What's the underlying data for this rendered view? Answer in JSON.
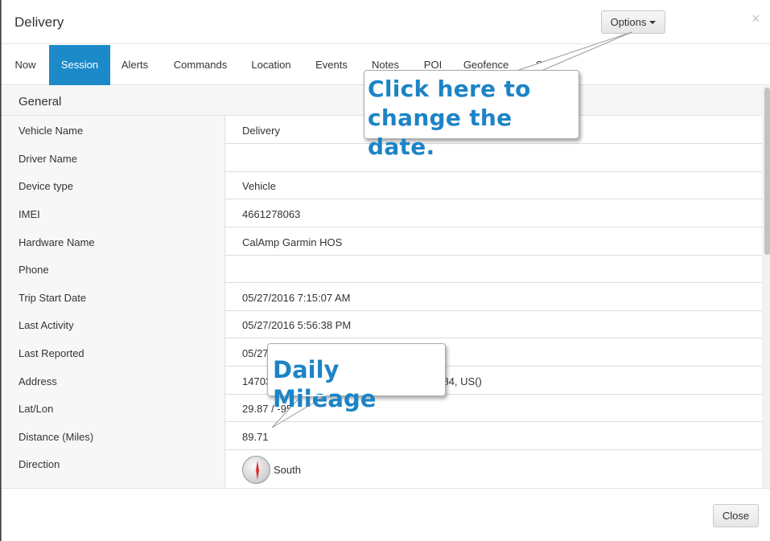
{
  "window": {
    "title": "Delivery",
    "options_label": "Options",
    "close_icon_glyph": "×"
  },
  "tabs": [
    {
      "label": "Now",
      "active": false
    },
    {
      "label": "Session",
      "active": true
    },
    {
      "label": "Alerts",
      "active": false
    },
    {
      "label": "Commands",
      "active": false
    },
    {
      "label": "Location",
      "active": false
    },
    {
      "label": "Events",
      "active": false
    },
    {
      "label": "Notes",
      "active": false
    },
    {
      "label": "POI",
      "active": false
    },
    {
      "label": "Geofence",
      "active": false
    },
    {
      "label": "St",
      "active": false
    }
  ],
  "section": {
    "title": "General"
  },
  "fields": [
    {
      "label": "Vehicle Name",
      "value": "Delivery"
    },
    {
      "label": "Driver Name",
      "value": ""
    },
    {
      "label": "Device type",
      "value": "Vehicle"
    },
    {
      "label": "IMEI",
      "value": "4661278063"
    },
    {
      "label": "Hardware Name",
      "value": "CalAmp Garmin HOS"
    },
    {
      "label": "Phone",
      "value": ""
    },
    {
      "label": "Trip Start Date",
      "value": "05/27/2016 7:15:07 AM"
    },
    {
      "label": "Last Activity",
      "value": "05/27/2016 5:56:38 PM"
    },
    {
      "label": "Last Reported",
      "value": "05/27"
    },
    {
      "label": "Address",
      "value": "14703"
    },
    {
      "label": "Lat/Lon",
      "value": "29.87 / -95"
    },
    {
      "label": "Distance (Miles)",
      "value": "89.71"
    },
    {
      "label": "Direction",
      "value": "South"
    }
  ],
  "address_visible_tail": "7084, US()",
  "latlon_visible_tail": "3",
  "callouts": {
    "date_line1": "Click here to",
    "date_line2": "change the date.",
    "mileage": "Daily Mileage"
  },
  "footer": {
    "close_label": "Close"
  },
  "colors": {
    "accent": "#1c89c9",
    "callout_text": "#1c84c6"
  },
  "icons": {
    "direction": "compass-icon"
  }
}
